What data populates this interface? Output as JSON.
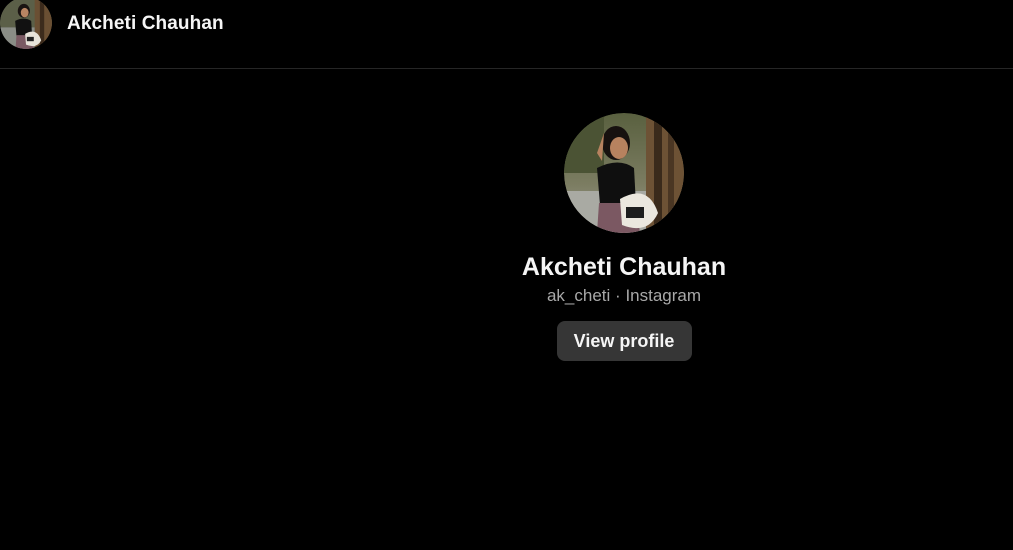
{
  "header": {
    "name": "Akcheti Chauhan",
    "avatar_icon": "profile-photo"
  },
  "profile": {
    "name": "Akcheti Chauhan",
    "username": "ak_cheti",
    "separator": "·",
    "platform": "Instagram",
    "subtitle": "ak_cheti · Instagram",
    "view_profile_label": "View profile"
  },
  "colors": {
    "background": "#000000",
    "text_primary": "#f5f5f5",
    "text_secondary": "#a8a8a8",
    "button_bg": "#363636",
    "divider": "#262626"
  }
}
